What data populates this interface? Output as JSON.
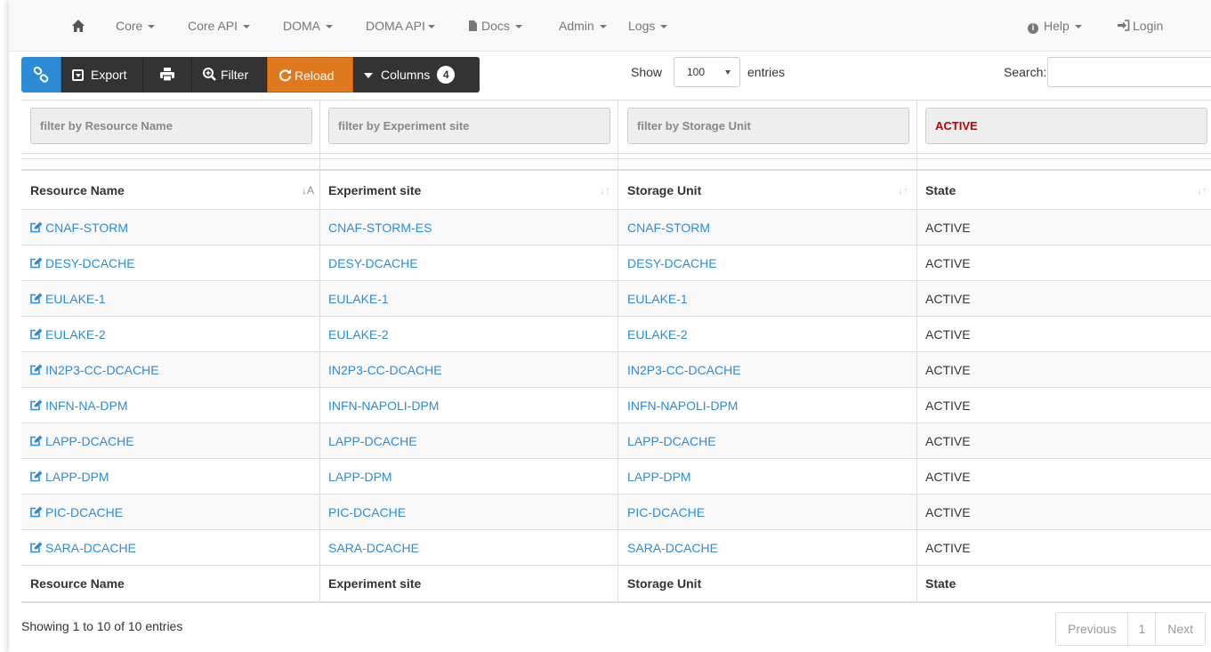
{
  "navbar": {
    "items": [
      {
        "label": "Core",
        "dropdown": true
      },
      {
        "label": "Core API",
        "dropdown": true
      },
      {
        "label": "DOMA",
        "dropdown": true
      },
      {
        "label": "DOMA API",
        "dropdown": true
      },
      {
        "label": "Docs",
        "dropdown": true,
        "icon": "document-icon"
      },
      {
        "label": "Admin",
        "dropdown": true
      },
      {
        "label": "Logs",
        "dropdown": true
      }
    ],
    "help": "Help",
    "login": "Login"
  },
  "toolbar": {
    "export": "Export",
    "filter": "Filter",
    "reload": "Reload",
    "columns": "Columns",
    "columns_count": "4"
  },
  "length": {
    "show": "Show",
    "value": "100",
    "entries": "entries"
  },
  "search": {
    "label": "Search:",
    "value": ""
  },
  "filters": {
    "resource_name": "filter by Resource Name",
    "experiment_site": "filter by Experiment site",
    "storage_unit": "filter by Storage Unit",
    "state": "ACTIVE"
  },
  "table": {
    "headers": [
      "Resource Name",
      "Experiment site",
      "Storage Unit",
      "State"
    ],
    "rows": [
      [
        "CNAF-STORM",
        "CNAF-STORM-ES",
        "CNAF-STORM",
        "ACTIVE"
      ],
      [
        "DESY-DCACHE",
        "DESY-DCACHE",
        "DESY-DCACHE",
        "ACTIVE"
      ],
      [
        "EULAKE-1",
        "EULAKE-1",
        "EULAKE-1",
        "ACTIVE"
      ],
      [
        "EULAKE-2",
        "EULAKE-2",
        "EULAKE-2",
        "ACTIVE"
      ],
      [
        "IN2P3-CC-DCACHE",
        "IN2P3-CC-DCACHE",
        "IN2P3-CC-DCACHE",
        "ACTIVE"
      ],
      [
        "INFN-NA-DPM",
        "INFN-NAPOLI-DPM",
        "INFN-NAPOLI-DPM",
        "ACTIVE"
      ],
      [
        "LAPP-DCACHE",
        "LAPP-DCACHE",
        "LAPP-DCACHE",
        "ACTIVE"
      ],
      [
        "LAPP-DPM",
        "LAPP-DPM",
        "LAPP-DPM",
        "ACTIVE"
      ],
      [
        "PIC-DCACHE",
        "PIC-DCACHE",
        "PIC-DCACHE",
        "ACTIVE"
      ],
      [
        "SARA-DCACHE",
        "SARA-DCACHE",
        "SARA-DCACHE",
        "ACTIVE"
      ]
    ]
  },
  "info": "Showing 1 to 10 of 10 entries",
  "pagination": {
    "previous": "Previous",
    "page": "1",
    "next": "Next"
  },
  "colors": {
    "link": "#2e8bd6",
    "reload": "#e0781e",
    "toolbar_dark": "#333333",
    "state_active_filter": "#c00000"
  }
}
